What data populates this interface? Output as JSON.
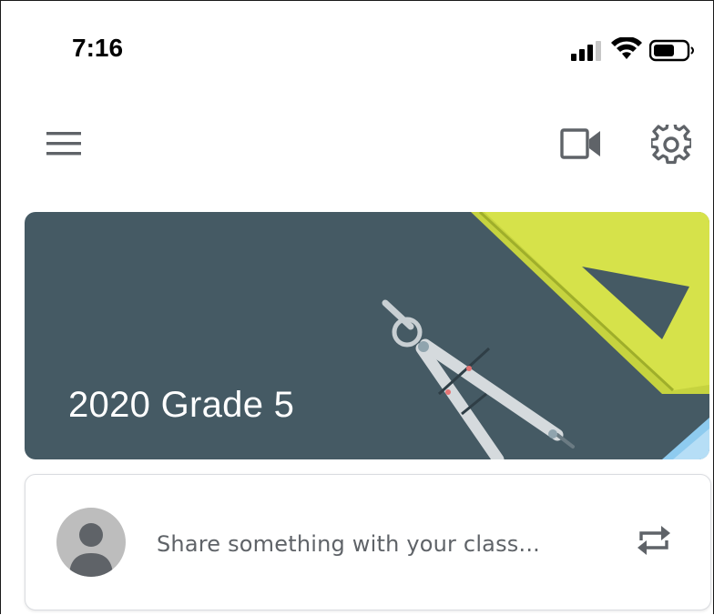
{
  "status_bar": {
    "time": "7:16",
    "icons": [
      "signal-icon",
      "wifi-icon",
      "battery-icon"
    ]
  },
  "app_bar": {
    "icons": [
      "menu-icon",
      "video-call-icon",
      "settings-icon"
    ]
  },
  "class_banner": {
    "title": "2020 Grade 5",
    "background_color": "#455a64"
  },
  "stream": {
    "share_placeholder": "Share something with your class...",
    "icons": [
      "avatar",
      "repost-icon"
    ]
  }
}
